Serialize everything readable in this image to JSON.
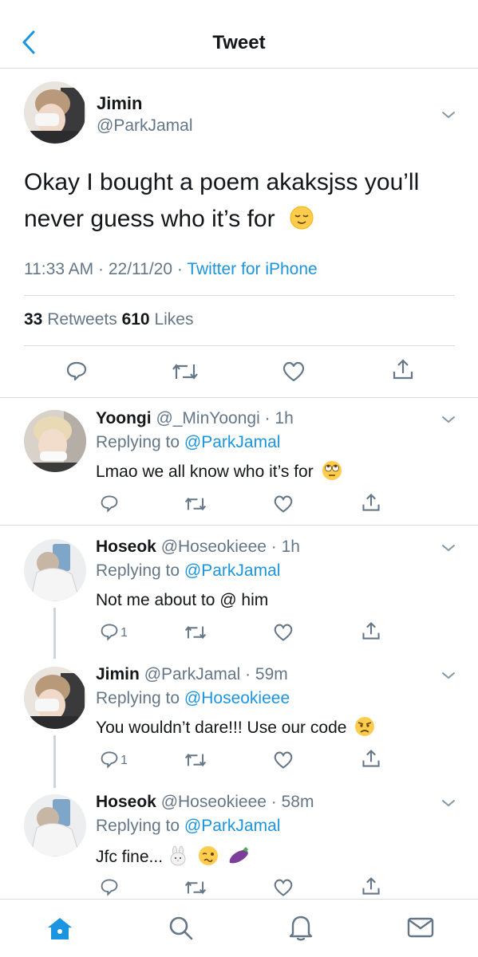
{
  "header": {
    "title": "Tweet"
  },
  "main_tweet": {
    "name": "Jimin",
    "handle": "@ParkJamal",
    "text_line1": "Okay I bought a poem akaksjss you’ll",
    "text_line2": "never guess who it’s for",
    "time": "11:33 AM · 22/11/20 · ",
    "source": "Twitter for iPhone",
    "retweets_count": "33",
    "retweets_label": " Retweets ",
    "likes_count": "610",
    "likes_label": " Likes"
  },
  "replies": [
    {
      "name": "Yoongi",
      "handle": "@_MinYoongi",
      "time": "· 1h",
      "replying_prefix": "Replying to ",
      "replying_to": "@ParkJamal",
      "text": "Lmao we all know who it’s for",
      "reply_count": ""
    },
    {
      "name": "Hoseok",
      "handle": "@Hoseokieee",
      "time": "· 1h",
      "replying_prefix": "Replying to ",
      "replying_to": "@ParkJamal",
      "text": "Not me about to @ him",
      "reply_count": "1"
    },
    {
      "name": "Jimin",
      "handle": "@ParkJamal",
      "time": "· 59m",
      "replying_prefix": "Replying to ",
      "replying_to": "@Hoseokieee",
      "text": "You wouldn’t dare!!! Use our code",
      "reply_count": "1"
    },
    {
      "name": "Hoseok",
      "handle": "@Hoseokieee",
      "time": "· 58m",
      "replying_prefix": "Replying to ",
      "replying_to": "@ParkJamal",
      "text": "Jfc fine...",
      "reply_count": ""
    }
  ],
  "icons": {
    "back": "chevron-left-icon",
    "more": "chevron-down-icon",
    "reply": "reply-icon",
    "retweet": "retweet-icon",
    "like": "heart-icon",
    "share": "share-icon",
    "home": "home-icon",
    "search": "search-icon",
    "notifications": "bell-icon",
    "messages": "mail-icon"
  },
  "colors": {
    "accent": "#1b95e0",
    "secondary_text": "#657786",
    "divider": "#d9dde0",
    "icon": "#657786"
  }
}
